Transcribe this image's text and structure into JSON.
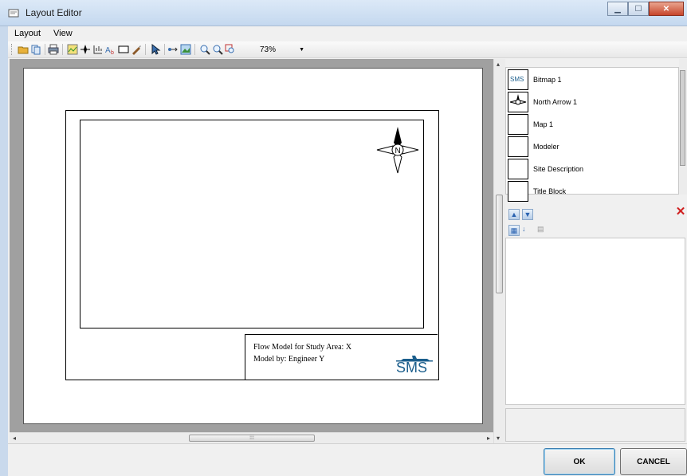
{
  "window": {
    "title": "Layout Editor"
  },
  "menu": [
    "Layout",
    "View"
  ],
  "toolbar": {
    "icons": [
      "open-icon",
      "copy-icon",
      "print-icon",
      "map-icon",
      "north-arrow-icon",
      "scale-bar-icon",
      "text-icon",
      "rectangle-icon",
      "brush-icon",
      "select-icon",
      "connector-icon",
      "image-icon",
      "zoom-in-icon",
      "zoom-out-icon",
      "zoom-fit-icon"
    ],
    "zoom_value": "73%"
  },
  "layout": {
    "title_block": {
      "line1": "Flow Model for Study Area: X",
      "line2": "Model by: Engineer Y"
    },
    "logo_text": "SMS",
    "north_letter": "N"
  },
  "items": [
    {
      "label": "Bitmap 1",
      "thumb": "SMS"
    },
    {
      "label": "North Arrow 1",
      "thumb": ""
    },
    {
      "label": "Map 1",
      "thumb": ""
    },
    {
      "label": "Modeler",
      "thumb": ""
    },
    {
      "label": "Site Description",
      "thumb": ""
    },
    {
      "label": "Title Block",
      "thumb": ""
    }
  ],
  "buttons": {
    "ok": "OK",
    "cancel": "CANCEL"
  },
  "colors": {
    "accent": "#3c7fb1",
    "logo": "#1b5e8c",
    "delete": "#d02020"
  }
}
